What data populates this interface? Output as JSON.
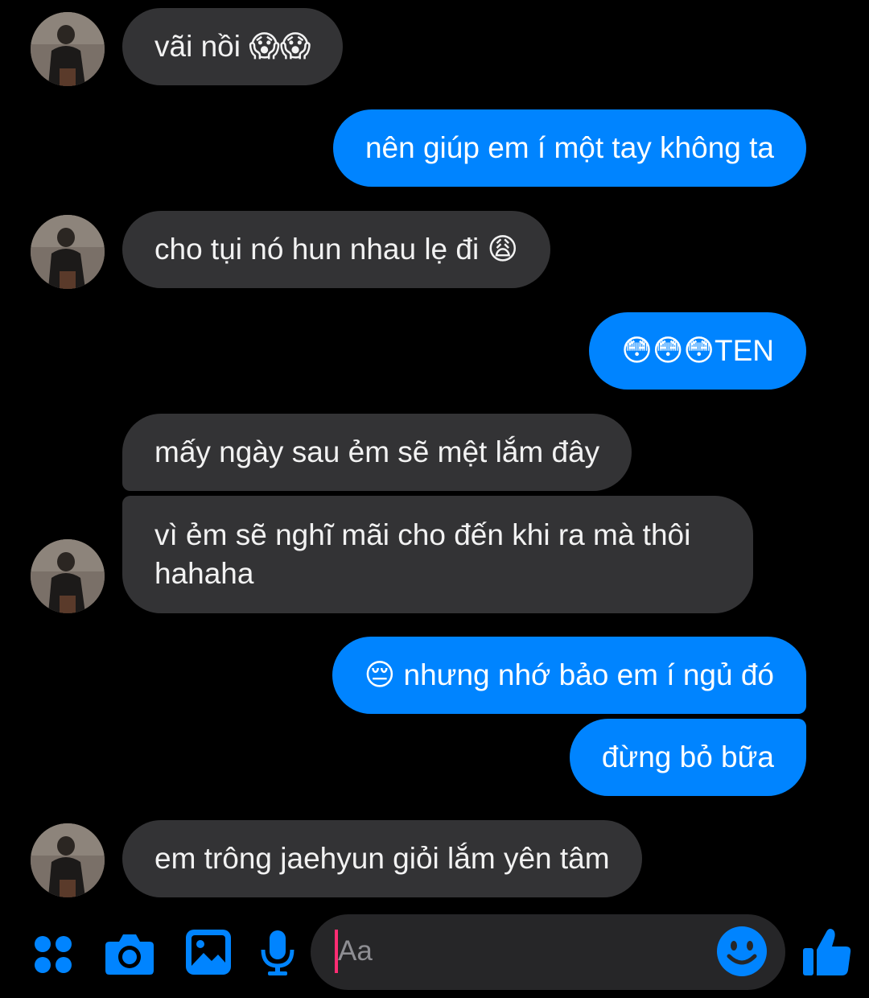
{
  "messages": [
    {
      "id": "m1",
      "side": "in",
      "text": "vãi nồi 😱😱"
    },
    {
      "id": "m2",
      "side": "out",
      "text": "nên giúp em í một tay không ta"
    },
    {
      "id": "m3",
      "side": "in",
      "text": "cho tụi nó hun nhau lẹ đi 😩"
    },
    {
      "id": "m4",
      "side": "out",
      "text": "😳😳😳TEN"
    },
    {
      "id": "m5",
      "side": "in",
      "text": "mấy ngày sau ẻm sẽ mệt lắm đây"
    },
    {
      "id": "m6",
      "side": "in",
      "text": "vì ẻm sẽ nghĩ mãi cho đến khi ra mà thôi hahaha"
    },
    {
      "id": "m7",
      "side": "out",
      "text": "😔 nhưng nhớ bảo em í ngủ đó"
    },
    {
      "id": "m8",
      "side": "out",
      "text": "đừng bỏ bữa"
    },
    {
      "id": "m9",
      "side": "in",
      "text": "em trông jaehyun giỏi lắm yên tâm"
    }
  ],
  "composer": {
    "placeholder": "Aa",
    "icons": [
      "more-apps-icon",
      "camera-icon",
      "gallery-icon",
      "microphone-icon",
      "emoji-icon",
      "thumbs-up-icon"
    ]
  },
  "colors": {
    "background": "#000000",
    "incoming_bubble": "#333335",
    "outgoing_bubble": "#0084ff",
    "accent": "#0084ff",
    "caret": "#ff2d73"
  }
}
